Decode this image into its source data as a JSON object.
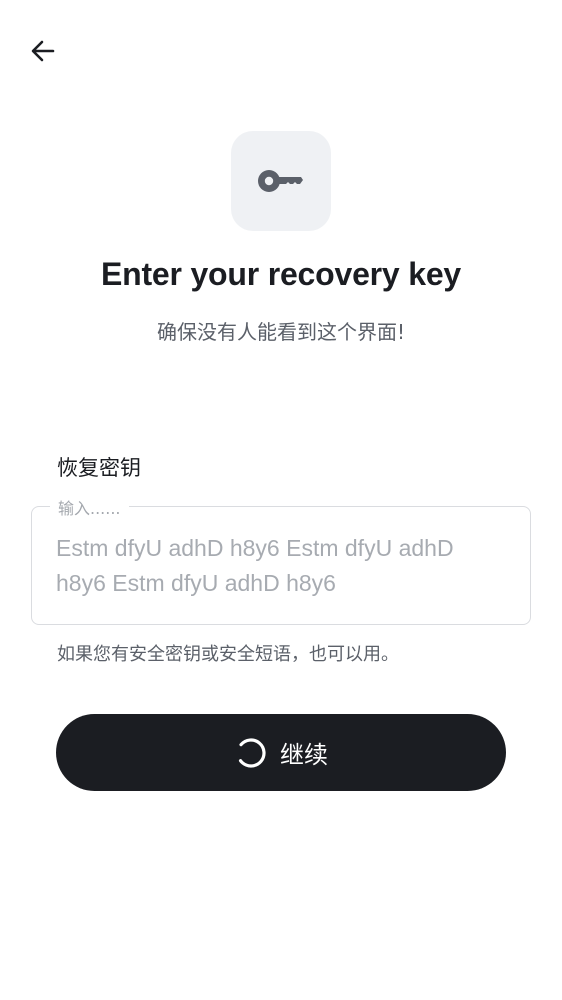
{
  "header": {
    "back_icon": "arrow-left-icon"
  },
  "hero": {
    "icon": "key-icon",
    "title": "Enter your recovery key",
    "subtitle": "确保没有人能看到这个界面!"
  },
  "form": {
    "label": "恢复密钥",
    "input_legend": "输入......",
    "input_value": "Estm dfyU adhD h8y6 Estm dfyU adhD h8y6 Estm dfyU adhD h8y6",
    "hint": "如果您有安全密钥或安全短语，也可以用。"
  },
  "continue_button": {
    "label": "继续",
    "state_icon": "loading-spinner-icon"
  },
  "colors": {
    "button_bg": "#1b1d22",
    "icon_tile_bg": "#eff1f4",
    "muted_text": "#5b6069",
    "placeholder_text": "#a7abb1"
  }
}
